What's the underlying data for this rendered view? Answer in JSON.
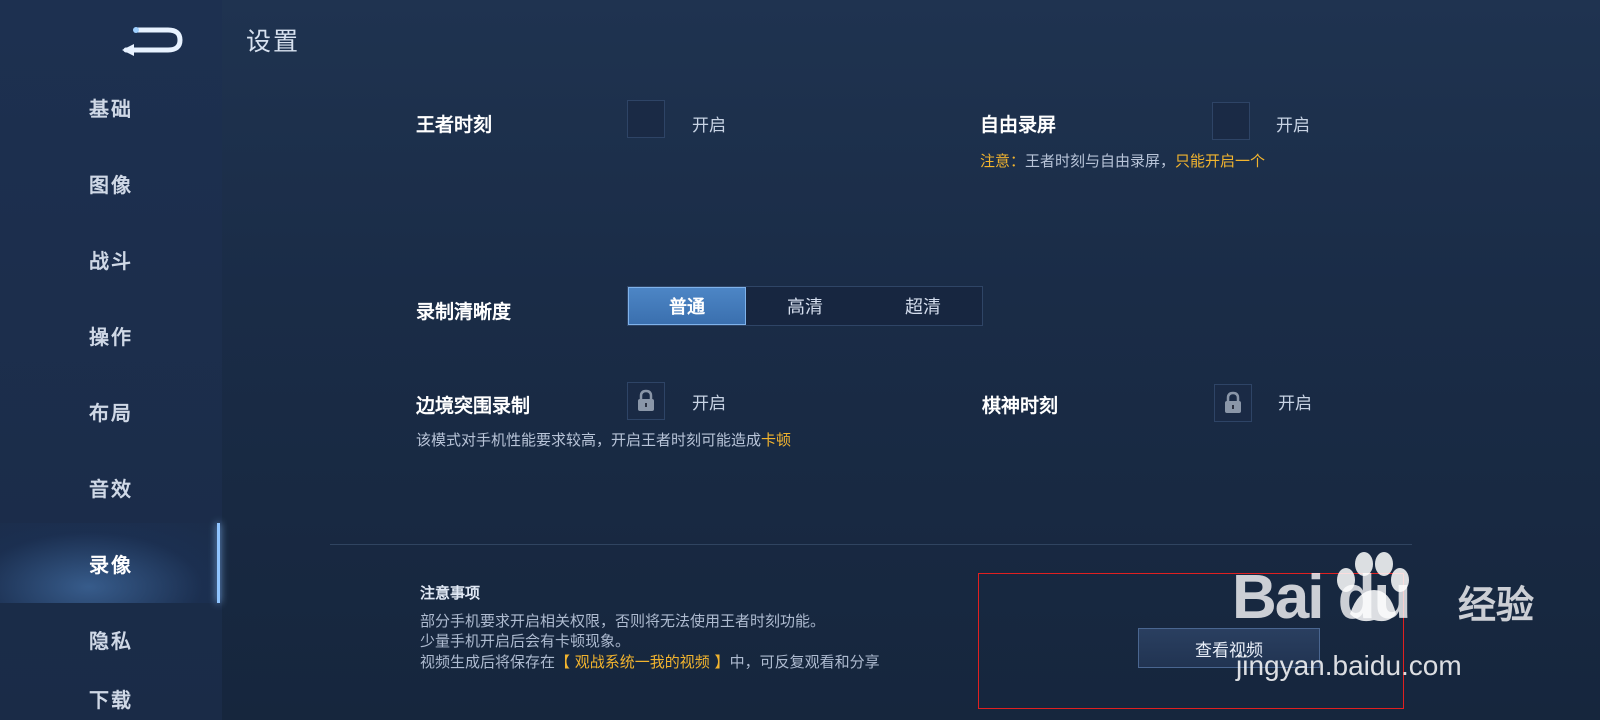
{
  "header": {
    "title": "设置"
  },
  "sidebar": {
    "items": [
      {
        "label": "基础"
      },
      {
        "label": "图像"
      },
      {
        "label": "战斗"
      },
      {
        "label": "操作"
      },
      {
        "label": "布局"
      },
      {
        "label": "音效"
      },
      {
        "label": "录像"
      },
      {
        "label": "隐私"
      },
      {
        "label": "下载"
      }
    ],
    "active": "录像"
  },
  "settings": {
    "wangzhe": {
      "label": "王者时刻",
      "toggle_text": "开启"
    },
    "freerecord": {
      "label": "自由录屏",
      "toggle_text": "开启"
    },
    "freerecord_note": {
      "prefix": "注意：",
      "middle": "王者时刻与自由录屏，",
      "suffix": "只能开启一个"
    },
    "quality": {
      "label": "录制清晰度",
      "options": [
        "普通",
        "高清",
        "超清"
      ],
      "selected": "普通"
    },
    "border": {
      "label": "边境突围录制",
      "toggle_text": "开启"
    },
    "chess": {
      "label": "棋神时刻",
      "toggle_text": "开启"
    },
    "perf_note": {
      "text": "该模式对手机性能要求较高，开启王者时刻可能造成",
      "highlight": "卡顿"
    }
  },
  "notes": {
    "title": "注意事项",
    "line1": "部分手机要求开启相关权限，否则将无法使用王者时刻功能。",
    "line2": "少量手机开启后会有卡顿现象。",
    "line3_prefix": "视频生成后将保存在",
    "line3_highlight": "【 观战系统一我的视频 】",
    "line3_suffix": "中，可反复观看和分享"
  },
  "view_video_button": "查看视频",
  "watermark": {
    "brand": "Bai du",
    "cn": "经验",
    "url": "jingyan.baidu.com"
  },
  "colors": {
    "accent": "#4d86c6",
    "warn": "#f2b42e",
    "highlight_frame": "#e02020"
  }
}
